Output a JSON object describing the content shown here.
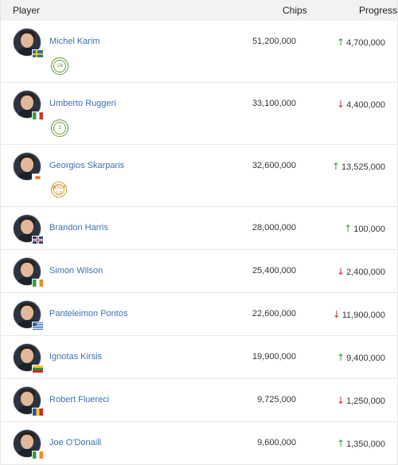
{
  "header": {
    "player": "Player",
    "chips": "Chips",
    "progress": "Progress"
  },
  "rows": [
    {
      "name": "Michel Karim",
      "chips": "51,200,000",
      "progress": "4,700,000",
      "direction": "up",
      "flag": "sweden",
      "badge": "18",
      "badge_style": "green"
    },
    {
      "name": "Umberto Ruggeri",
      "chips": "33,100,000",
      "progress": "4,400,000",
      "direction": "down",
      "flag": "italy",
      "badge": "3",
      "badge_style": "green"
    },
    {
      "name": "Georgios Skarparis",
      "chips": "32,600,000",
      "progress": "13,525,000",
      "direction": "up",
      "flag": "cyprus",
      "badge": "WSOP 1X",
      "badge_style": "gold"
    },
    {
      "name": "Brandon Harris",
      "chips": "28,000,000",
      "progress": "100,000",
      "direction": "up",
      "flag": "uk"
    },
    {
      "name": "Simon Wilson",
      "chips": "25,400,000",
      "progress": "2,400,000",
      "direction": "down",
      "flag": "ireland"
    },
    {
      "name": "Panteleimon Pontos",
      "chips": "22,600,000",
      "progress": "11,900,000",
      "direction": "down",
      "flag": "greece"
    },
    {
      "name": "Ignotas Kirsis",
      "chips": "19,900,000",
      "progress": "9,400,000",
      "direction": "up",
      "flag": "lithuania"
    },
    {
      "name": "Robert Fluereci",
      "chips": "9,725,000",
      "progress": "1,250,000",
      "direction": "down",
      "flag": "romania"
    },
    {
      "name": "Joe O'Donaill",
      "chips": "9,600,000",
      "progress": "1,350,000",
      "direction": "up",
      "flag": "ireland"
    }
  ],
  "colors": {
    "link": "#3e6fb3",
    "up": "#3b9b3b",
    "down": "#d12f2f",
    "header_bg": "#f2f2f2"
  }
}
